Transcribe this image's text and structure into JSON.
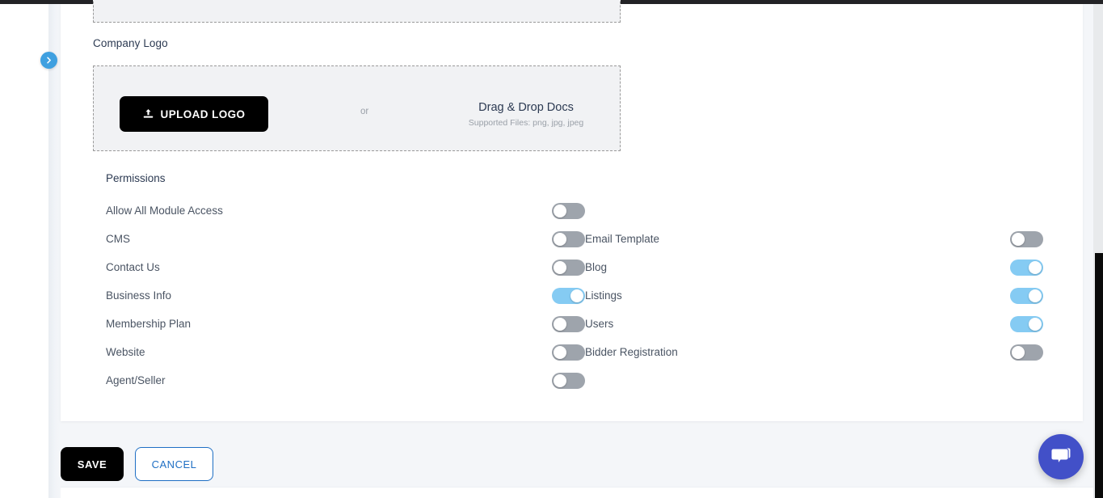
{
  "window": {
    "background_color": "#f4f6f9",
    "card_color": "#ffffff",
    "accent_color": "#1f6fc4",
    "toggle_on_color": "#85cbf3",
    "toggle_off_color": "#9ea4ac",
    "chat_color": "#4250c8"
  },
  "sidebar": {
    "toggle_icon": "chevron-right-icon"
  },
  "company_logo": {
    "label": "Company Logo",
    "upload_button": "UPLOAD LOGO",
    "upload_icon": "upload-icon",
    "or_text": "or",
    "dnd_title": "Drag & Drop Docs",
    "dnd_subtitle": "Supported Files: png, jpg, jpeg"
  },
  "permissions": {
    "heading": "Permissions",
    "rows": [
      {
        "left": {
          "label": "Allow All Module Access",
          "on": false
        },
        "right": {
          "label": "",
          "on": false,
          "empty": true
        }
      },
      {
        "left": {
          "label": "CMS",
          "on": false
        },
        "right": {
          "label": "Email Template",
          "on": false
        }
      },
      {
        "left": {
          "label": "Contact Us",
          "on": false
        },
        "right": {
          "label": "Blog",
          "on": true
        }
      },
      {
        "left": {
          "label": "Business Info",
          "on": true
        },
        "right": {
          "label": "Listings",
          "on": true
        }
      },
      {
        "left": {
          "label": "Membership Plan",
          "on": false
        },
        "right": {
          "label": "Users",
          "on": true
        }
      },
      {
        "left": {
          "label": "Website",
          "on": false
        },
        "right": {
          "label": "Bidder Registration",
          "on": false
        }
      },
      {
        "left": {
          "label": "Agent/Seller",
          "on": false
        },
        "right": {
          "label": "",
          "on": false,
          "empty": true
        }
      }
    ]
  },
  "actions": {
    "save_label": "SAVE",
    "cancel_label": "CANCEL"
  },
  "chat": {
    "icon": "chat-bubble-icon"
  }
}
